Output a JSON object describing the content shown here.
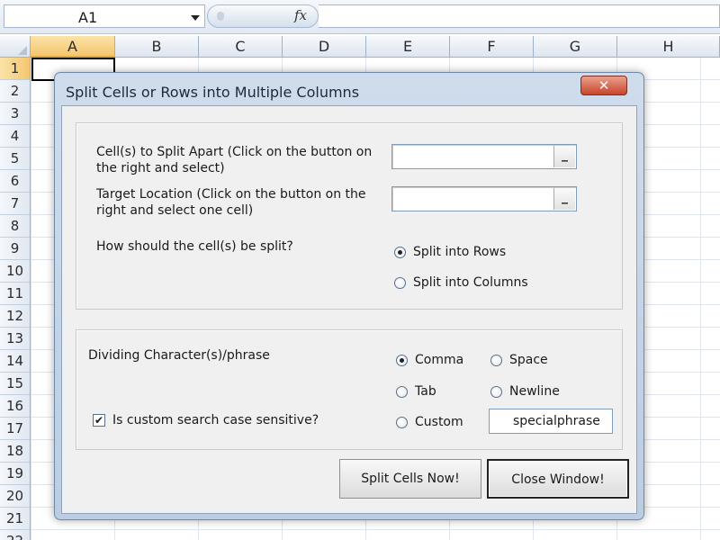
{
  "spreadsheet": {
    "name_box": "A1",
    "fx_icon": "fx",
    "columns": [
      "A",
      "B",
      "C",
      "D",
      "E",
      "F",
      "G",
      "H"
    ],
    "rows": [
      "1",
      "2",
      "3",
      "4",
      "5",
      "6",
      "7",
      "8",
      "9",
      "10",
      "11",
      "12",
      "13",
      "14",
      "15",
      "16",
      "17",
      "18",
      "19",
      "20",
      "21",
      "22"
    ]
  },
  "dialog": {
    "title": "Split Cells or Rows into Multiple Columns",
    "close_glyph": "✕",
    "cells_label_line1": "Cell(s) to Split Apart (Click on the button on",
    "cells_label_line2": "the right and select)",
    "target_label_line1": "Target Location (Click on the button on the",
    "target_label_line2": "right and select one cell)",
    "picker_glyph": "_",
    "split_question": "How should the cell(s) be split?",
    "split_options": [
      {
        "label": "Split into Rows",
        "selected": true
      },
      {
        "label": "Split into Columns",
        "selected": false
      }
    ],
    "dividing_label": "Dividing Character(s)/phrase",
    "divider_options": [
      {
        "label": "Comma",
        "selected": true
      },
      {
        "label": "Space",
        "selected": false
      },
      {
        "label": "Tab",
        "selected": false
      },
      {
        "label": "Newline",
        "selected": false
      },
      {
        "label": "Custom",
        "selected": false
      }
    ],
    "custom_value": "specialphrase",
    "case_sensitive_label": "Is custom search case sensitive?",
    "case_sensitive_checked": true,
    "check_glyph": "✔",
    "split_button": "Split Cells Now!",
    "close_button": "Close Window!"
  }
}
